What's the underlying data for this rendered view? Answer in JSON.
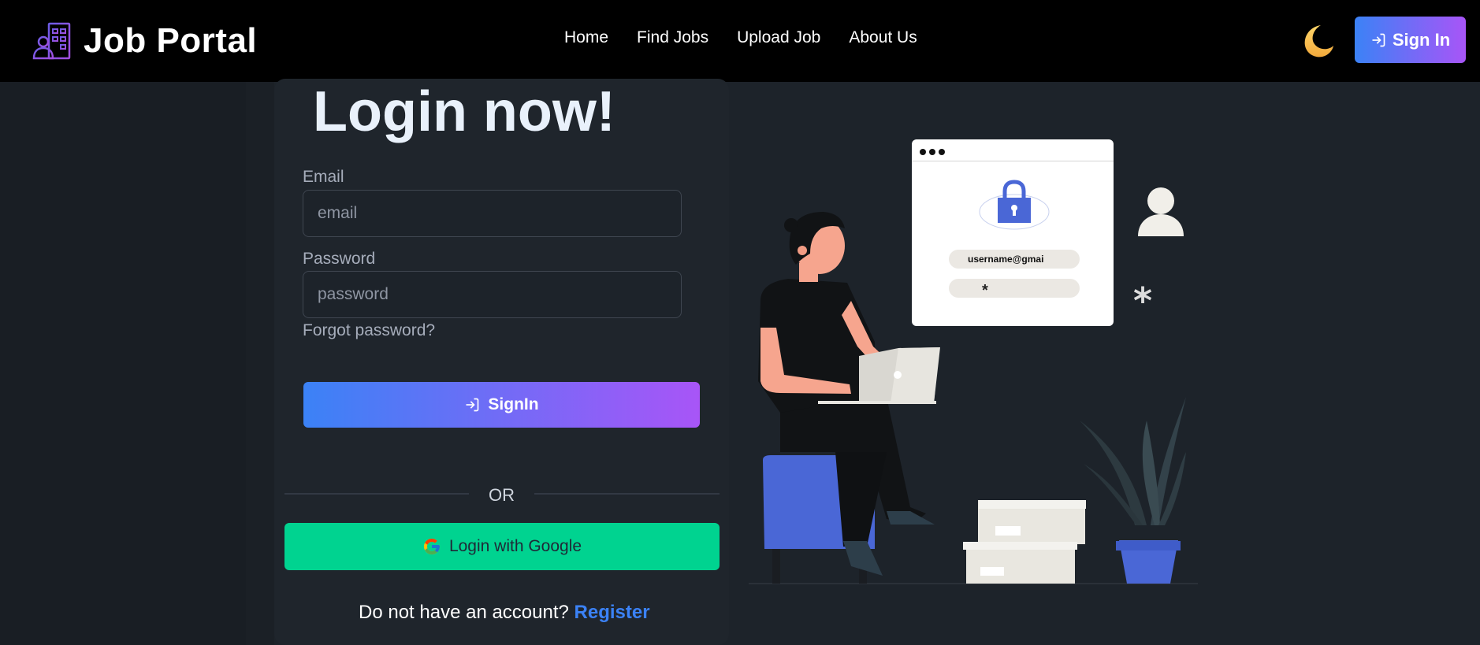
{
  "nav": {
    "brand": "Job Portal",
    "links": [
      "Home",
      "Find Jobs",
      "Upload Job",
      "About Us"
    ],
    "signin_label": "Sign In",
    "theme_icon": "moon-icon"
  },
  "login": {
    "title": "Login now!",
    "email_label": "Email",
    "email_placeholder": "email",
    "password_label": "Password",
    "password_placeholder": "password",
    "forgot_label": "Forgot password?",
    "signin_label": "SignIn",
    "or_label": "OR",
    "google_label": "Login with Google",
    "no_account_text": "Do not have an account?",
    "register_label": "Register"
  },
  "illustration": {
    "username_text": "username@gmai",
    "password_mask": "*"
  },
  "colors": {
    "navbar_bg": "#000000",
    "page_bg": "#1d232a",
    "gradient_start": "#3b82f6",
    "gradient_end": "#a855f7",
    "google_button": "#00d390",
    "register_link": "#3b82f6"
  }
}
